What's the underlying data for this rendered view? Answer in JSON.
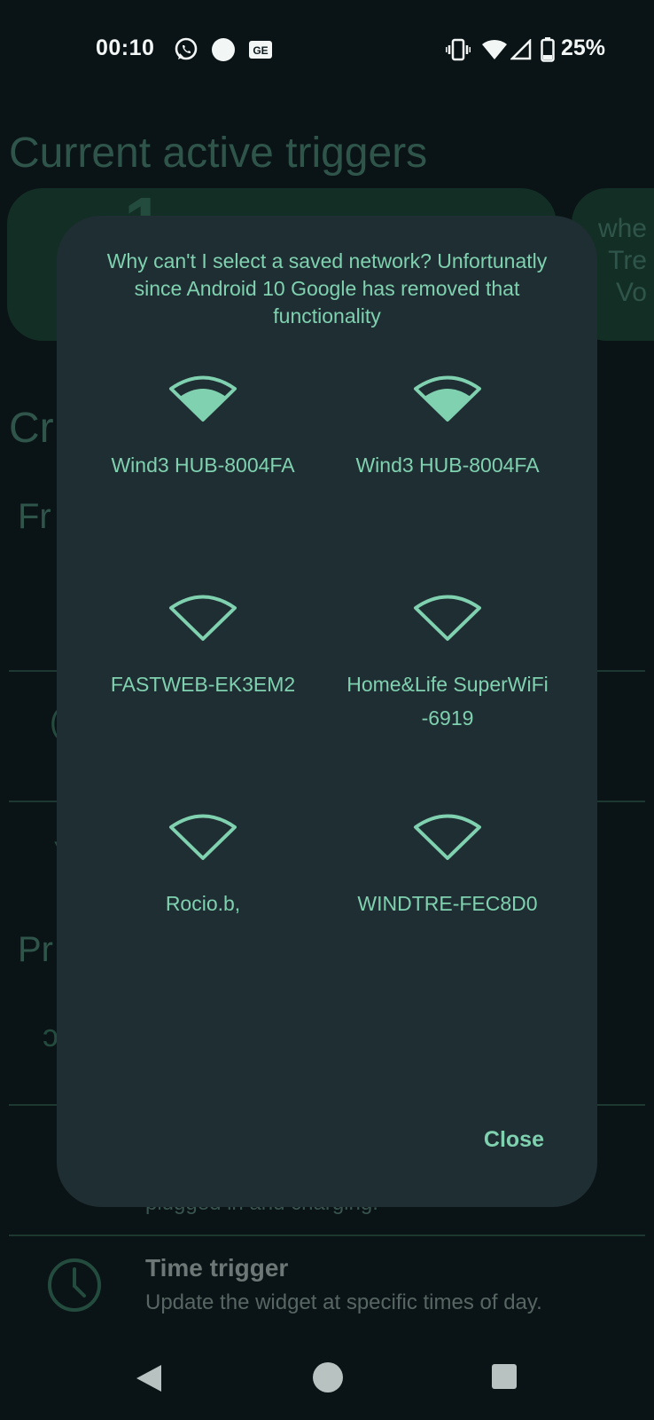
{
  "status_bar": {
    "time": "00:10",
    "battery": "25%",
    "icons": [
      "whatsapp-icon",
      "circle-notification-icon",
      "news-icon",
      "vibrate-icon",
      "wifi-icon",
      "cell-signal-icon",
      "battery-icon"
    ]
  },
  "background": {
    "title": "Current active triggers",
    "card_digit": "1",
    "card_side_text": "whe Tre Vo",
    "section_create": "Cr",
    "section_from": "Fr",
    "section_pr": "Pr",
    "charging_text": "plugged in and charging.",
    "time_trigger": {
      "title": "Time trigger",
      "description": "Update the widget at specific times of day."
    }
  },
  "dialog": {
    "message": "Why can't I select a saved network? Unfortunatly since Android 10 Google has removed that functionality",
    "networks": [
      {
        "name": "Wind3 HUB-8004FA",
        "connected": true
      },
      {
        "name": "Wind3 HUB-8004FA",
        "connected": true
      },
      {
        "name": "FASTWEB-EK3EM2",
        "connected": false
      },
      {
        "name": "Home&Life SuperWiFi-6919",
        "connected": false
      },
      {
        "name": "Rocio.b,",
        "connected": false
      },
      {
        "name": "WINDTRE-FEC8D0",
        "connected": false
      }
    ],
    "close_label": "Close"
  },
  "colors": {
    "accent": "#7fd1b0",
    "dialog_bg": "#1f2e32",
    "screen_bg": "#0f1a1c"
  }
}
